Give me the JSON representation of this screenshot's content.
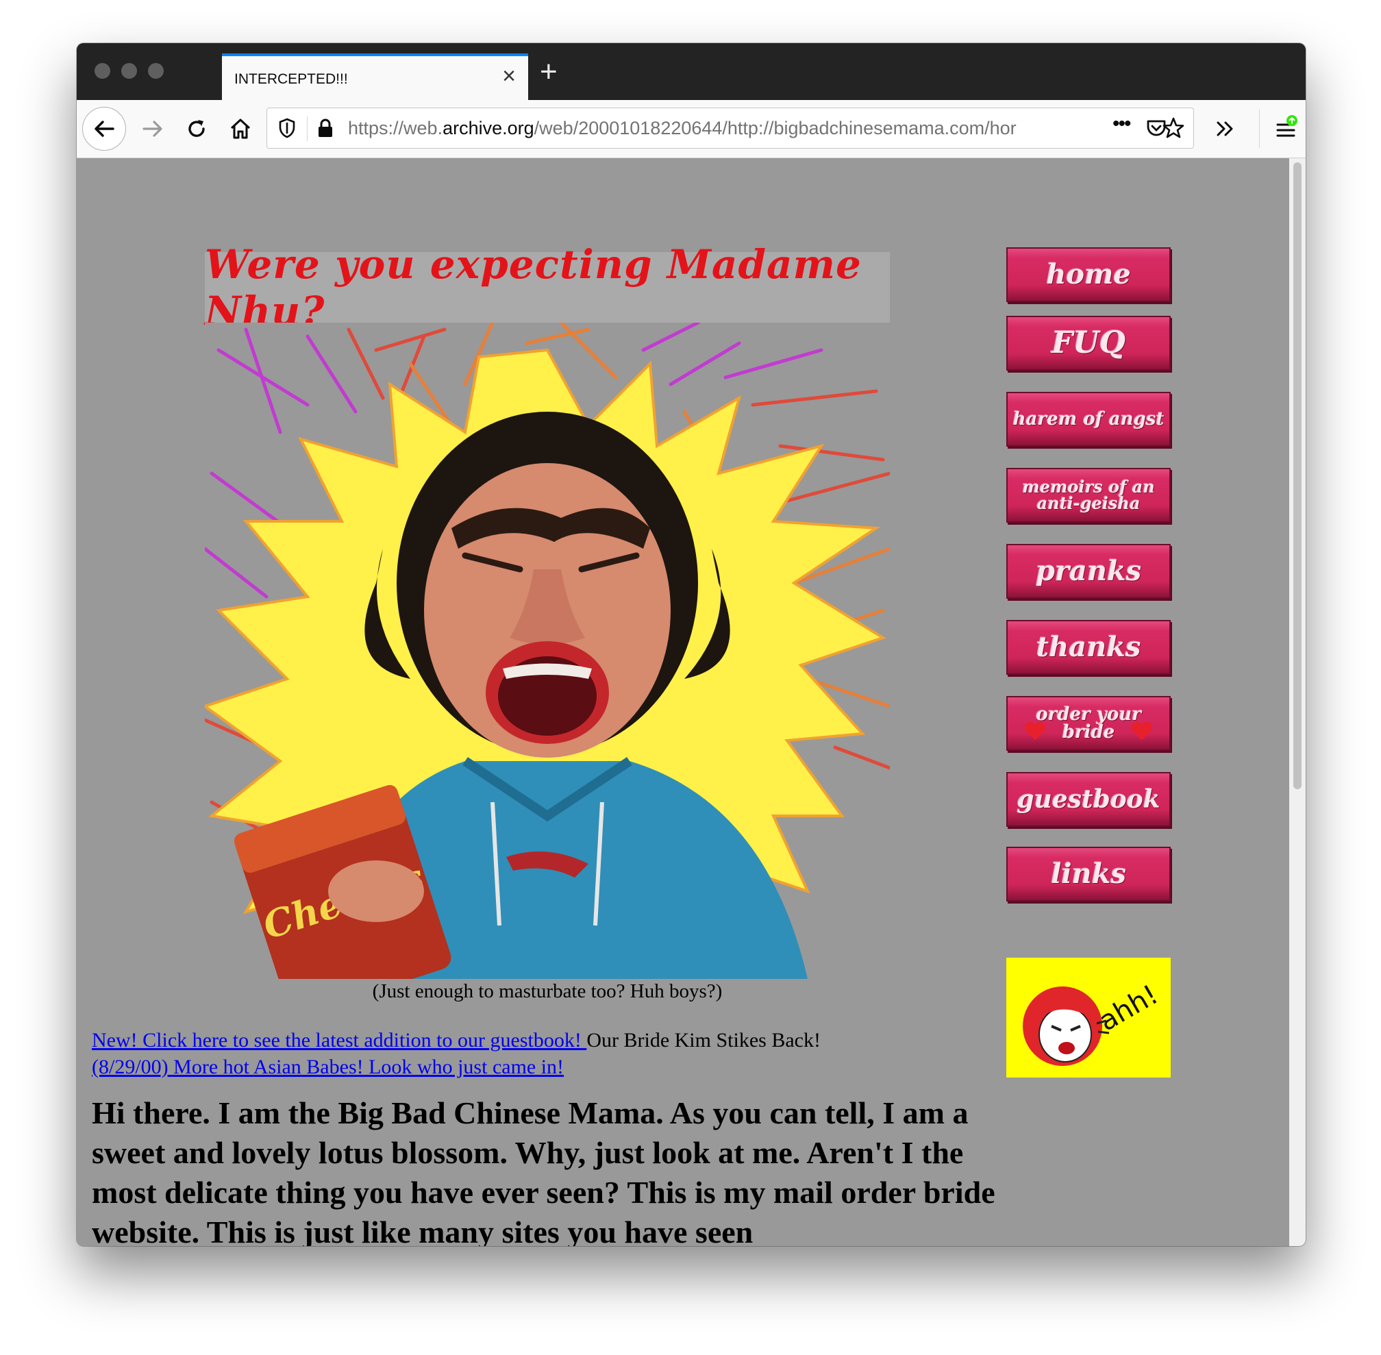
{
  "browser": {
    "tab_title": "INTERCEPTED!!!",
    "url_prefix": "https://web.",
    "url_host": "archive.org",
    "url_rest": "/web/20001018220644/http://bigbadchinesemama.com/hor"
  },
  "page": {
    "banner_text": "Were you expecting Madame Nhu?",
    "photo_caption": "(Just enough to masturbate too? Huh boys?)",
    "snack_bag_text": "Cheetos",
    "link_guestbook": "New! Click here to see the latest addition to our guestbook! ",
    "guestbook_note": "Our Bride Kim Stikes Back!",
    "link_babes": "(8/29/00) More hot Asian Babes! Look who just came in!",
    "intro_text": "Hi there. I am the Big Bad Chinese Mama. As you can tell, I am a sweet and lovely lotus blossom. Why, just look at me. Aren't I the most delicate thing you have ever seen? This is my mail order bride website. This is just like many sites you have seen"
  },
  "nav": {
    "buttons": [
      {
        "line1": "home",
        "line2": ""
      },
      {
        "line1": "FUQ",
        "line2": ""
      },
      {
        "line1": "harem of angst",
        "line2": ""
      },
      {
        "line1": "memoirs of an",
        "line2": "anti-geisha"
      },
      {
        "line1": "pranks",
        "line2": ""
      },
      {
        "line1": "thanks",
        "line2": ""
      },
      {
        "line1": "order your",
        "line2": "bride"
      },
      {
        "line1": "guestbook",
        "line2": ""
      },
      {
        "line1": "links",
        "line2": ""
      }
    ],
    "sticker_text": "ahh!"
  },
  "colors": {
    "page_bg": "#999999",
    "banner_text": "#e3131a",
    "button_pink": "#d82b64",
    "starburst": "#fff04a",
    "sticker_bg": "#ffff00",
    "link": "#0000ee"
  }
}
